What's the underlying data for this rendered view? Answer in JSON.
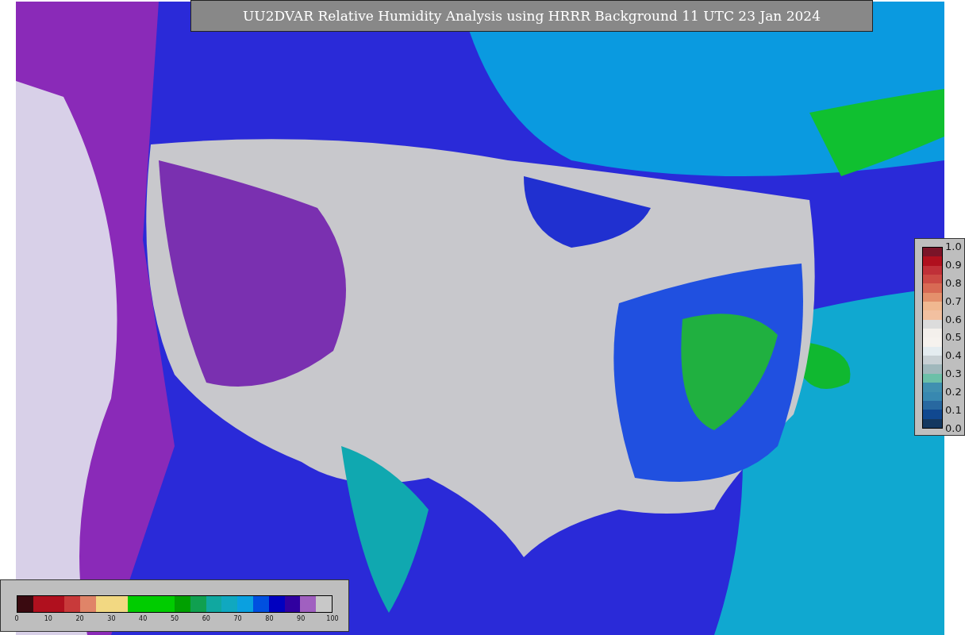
{
  "title": "UU2DVAR Relative Humidity Analysis using HRRR Background 11 UTC 23 Jan 2024",
  "right_colorbar": {
    "ticks": [
      "1.0",
      "0.9",
      "0.8",
      "0.7",
      "0.6",
      "0.5",
      "0.4",
      "0.3",
      "0.2",
      "0.1",
      "0.0"
    ],
    "segments": [
      {
        "color": "#7a1428"
      },
      {
        "color": "#b0101e"
      },
      {
        "color": "#c03038"
      },
      {
        "color": "#cc4a44"
      },
      {
        "color": "#d86a54"
      },
      {
        "color": "#e4906c"
      },
      {
        "color": "#f0b890"
      },
      {
        "color": "#f2c0a0"
      },
      {
        "color": "#dcdcdc"
      },
      {
        "color": "#f4f0ec"
      },
      {
        "color": "#f6f2ee"
      },
      {
        "color": "#e4ecf0"
      },
      {
        "color": "#c8d0d4"
      },
      {
        "color": "#a0b8bc"
      },
      {
        "color": "#6cc0a8"
      },
      {
        "color": "#4090b0"
      },
      {
        "color": "#3888b0"
      },
      {
        "color": "#2868a0"
      },
      {
        "color": "#104890"
      },
      {
        "color": "#143860"
      }
    ]
  },
  "bottom_colorbar": {
    "ticks": [
      "0",
      "10",
      "20",
      "30",
      "40",
      "50",
      "60",
      "70",
      "80",
      "90",
      "100"
    ],
    "segments": [
      {
        "color": "#3a0a10"
      },
      {
        "color": "#b0101e"
      },
      {
        "color": "#b0101e"
      },
      {
        "color": "#c83a3a"
      },
      {
        "color": "#e08468"
      },
      {
        "color": "#f2d882"
      },
      {
        "color": "#f2d882"
      },
      {
        "color": "#00cc00"
      },
      {
        "color": "#00cc00"
      },
      {
        "color": "#00cc00"
      },
      {
        "color": "#00a000"
      },
      {
        "color": "#10a050"
      },
      {
        "color": "#10a8a0"
      },
      {
        "color": "#10a8c0"
      },
      {
        "color": "#0aa0e0"
      },
      {
        "color": "#0050e0"
      },
      {
        "color": "#0000c0"
      },
      {
        "color": "#3000a0"
      },
      {
        "color": "#a060c0"
      },
      {
        "color": "#c8c8c8"
      }
    ]
  }
}
